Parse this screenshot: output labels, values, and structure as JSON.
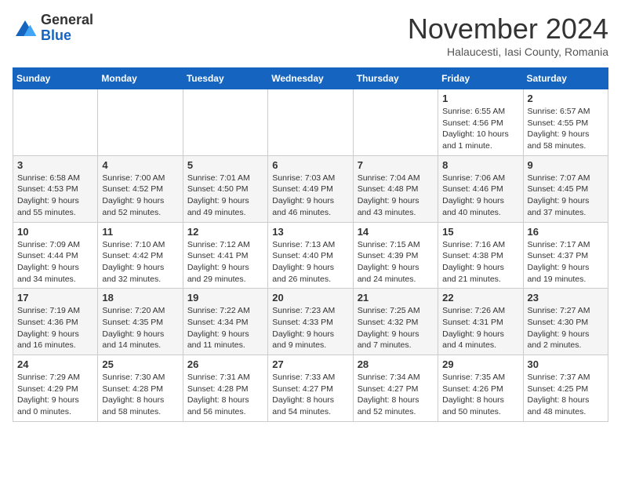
{
  "header": {
    "logo_line1": "General",
    "logo_line2": "Blue",
    "month_title": "November 2024",
    "location": "Halaucesti, Iasi County, Romania"
  },
  "weekdays": [
    "Sunday",
    "Monday",
    "Tuesday",
    "Wednesday",
    "Thursday",
    "Friday",
    "Saturday"
  ],
  "weeks": [
    [
      {
        "day": "",
        "detail": ""
      },
      {
        "day": "",
        "detail": ""
      },
      {
        "day": "",
        "detail": ""
      },
      {
        "day": "",
        "detail": ""
      },
      {
        "day": "",
        "detail": ""
      },
      {
        "day": "1",
        "detail": "Sunrise: 6:55 AM\nSunset: 4:56 PM\nDaylight: 10 hours and 1 minute."
      },
      {
        "day": "2",
        "detail": "Sunrise: 6:57 AM\nSunset: 4:55 PM\nDaylight: 9 hours and 58 minutes."
      }
    ],
    [
      {
        "day": "3",
        "detail": "Sunrise: 6:58 AM\nSunset: 4:53 PM\nDaylight: 9 hours and 55 minutes."
      },
      {
        "day": "4",
        "detail": "Sunrise: 7:00 AM\nSunset: 4:52 PM\nDaylight: 9 hours and 52 minutes."
      },
      {
        "day": "5",
        "detail": "Sunrise: 7:01 AM\nSunset: 4:50 PM\nDaylight: 9 hours and 49 minutes."
      },
      {
        "day": "6",
        "detail": "Sunrise: 7:03 AM\nSunset: 4:49 PM\nDaylight: 9 hours and 46 minutes."
      },
      {
        "day": "7",
        "detail": "Sunrise: 7:04 AM\nSunset: 4:48 PM\nDaylight: 9 hours and 43 minutes."
      },
      {
        "day": "8",
        "detail": "Sunrise: 7:06 AM\nSunset: 4:46 PM\nDaylight: 9 hours and 40 minutes."
      },
      {
        "day": "9",
        "detail": "Sunrise: 7:07 AM\nSunset: 4:45 PM\nDaylight: 9 hours and 37 minutes."
      }
    ],
    [
      {
        "day": "10",
        "detail": "Sunrise: 7:09 AM\nSunset: 4:44 PM\nDaylight: 9 hours and 34 minutes."
      },
      {
        "day": "11",
        "detail": "Sunrise: 7:10 AM\nSunset: 4:42 PM\nDaylight: 9 hours and 32 minutes."
      },
      {
        "day": "12",
        "detail": "Sunrise: 7:12 AM\nSunset: 4:41 PM\nDaylight: 9 hours and 29 minutes."
      },
      {
        "day": "13",
        "detail": "Sunrise: 7:13 AM\nSunset: 4:40 PM\nDaylight: 9 hours and 26 minutes."
      },
      {
        "day": "14",
        "detail": "Sunrise: 7:15 AM\nSunset: 4:39 PM\nDaylight: 9 hours and 24 minutes."
      },
      {
        "day": "15",
        "detail": "Sunrise: 7:16 AM\nSunset: 4:38 PM\nDaylight: 9 hours and 21 minutes."
      },
      {
        "day": "16",
        "detail": "Sunrise: 7:17 AM\nSunset: 4:37 PM\nDaylight: 9 hours and 19 minutes."
      }
    ],
    [
      {
        "day": "17",
        "detail": "Sunrise: 7:19 AM\nSunset: 4:36 PM\nDaylight: 9 hours and 16 minutes."
      },
      {
        "day": "18",
        "detail": "Sunrise: 7:20 AM\nSunset: 4:35 PM\nDaylight: 9 hours and 14 minutes."
      },
      {
        "day": "19",
        "detail": "Sunrise: 7:22 AM\nSunset: 4:34 PM\nDaylight: 9 hours and 11 minutes."
      },
      {
        "day": "20",
        "detail": "Sunrise: 7:23 AM\nSunset: 4:33 PM\nDaylight: 9 hours and 9 minutes."
      },
      {
        "day": "21",
        "detail": "Sunrise: 7:25 AM\nSunset: 4:32 PM\nDaylight: 9 hours and 7 minutes."
      },
      {
        "day": "22",
        "detail": "Sunrise: 7:26 AM\nSunset: 4:31 PM\nDaylight: 9 hours and 4 minutes."
      },
      {
        "day": "23",
        "detail": "Sunrise: 7:27 AM\nSunset: 4:30 PM\nDaylight: 9 hours and 2 minutes."
      }
    ],
    [
      {
        "day": "24",
        "detail": "Sunrise: 7:29 AM\nSunset: 4:29 PM\nDaylight: 9 hours and 0 minutes."
      },
      {
        "day": "25",
        "detail": "Sunrise: 7:30 AM\nSunset: 4:28 PM\nDaylight: 8 hours and 58 minutes."
      },
      {
        "day": "26",
        "detail": "Sunrise: 7:31 AM\nSunset: 4:28 PM\nDaylight: 8 hours and 56 minutes."
      },
      {
        "day": "27",
        "detail": "Sunrise: 7:33 AM\nSunset: 4:27 PM\nDaylight: 8 hours and 54 minutes."
      },
      {
        "day": "28",
        "detail": "Sunrise: 7:34 AM\nSunset: 4:27 PM\nDaylight: 8 hours and 52 minutes."
      },
      {
        "day": "29",
        "detail": "Sunrise: 7:35 AM\nSunset: 4:26 PM\nDaylight: 8 hours and 50 minutes."
      },
      {
        "day": "30",
        "detail": "Sunrise: 7:37 AM\nSunset: 4:25 PM\nDaylight: 8 hours and 48 minutes."
      }
    ]
  ]
}
